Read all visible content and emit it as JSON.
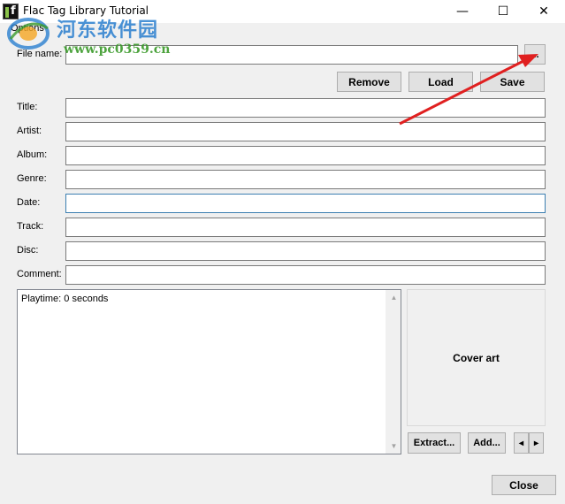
{
  "window": {
    "title": "Flac Tag Library Tutorial",
    "minimize_glyph": "—",
    "maximize_glyph": "☐",
    "close_glyph": "✕"
  },
  "menu": {
    "options": "Options"
  },
  "watermark": {
    "text": "河东软件园",
    "url": "www.pc0359.cn"
  },
  "file": {
    "label": "File name:",
    "value": "",
    "browse_label": "..."
  },
  "buttons": {
    "remove": "Remove",
    "load": "Load",
    "save": "Save"
  },
  "fields": {
    "title": {
      "label": "Title:",
      "value": ""
    },
    "artist": {
      "label": "Artist:",
      "value": ""
    },
    "album": {
      "label": "Album:",
      "value": ""
    },
    "genre": {
      "label": "Genre:",
      "value": ""
    },
    "date": {
      "label": "Date:",
      "value": ""
    },
    "track": {
      "label": "Track:",
      "value": ""
    },
    "disc": {
      "label": "Disc:",
      "value": ""
    },
    "comment": {
      "label": "Comment:",
      "value": ""
    }
  },
  "info": {
    "text": "Playtime: 0 seconds"
  },
  "cover": {
    "label": "Cover art",
    "extract": "Extract...",
    "add": "Add...",
    "prev": "◂",
    "next": "▸"
  },
  "footer": {
    "close": "Close"
  },
  "colors": {
    "arrow": "#e02020",
    "focus_border": "#3c7fb1",
    "watermark_blue": "#2a7fcf",
    "watermark_green": "#3a9a2a"
  }
}
